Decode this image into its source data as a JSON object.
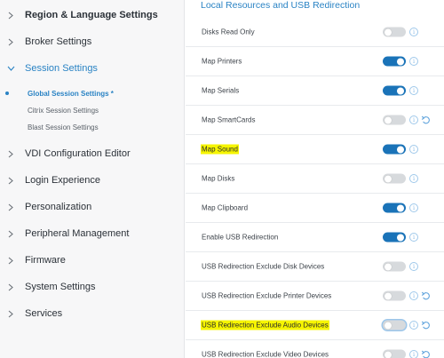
{
  "sidebar": {
    "items": [
      {
        "label": "Region & Language Settings",
        "bold": true,
        "expanded": false
      },
      {
        "label": "Broker Settings",
        "bold": false,
        "expanded": false
      },
      {
        "label": "Session Settings",
        "bold": false,
        "expanded": true,
        "active": true
      },
      {
        "label": "VDI Configuration Editor",
        "bold": false,
        "expanded": false
      },
      {
        "label": "Login Experience",
        "bold": false,
        "expanded": false
      },
      {
        "label": "Personalization",
        "bold": false,
        "expanded": false
      },
      {
        "label": "Peripheral Management",
        "bold": false,
        "expanded": false
      },
      {
        "label": "Firmware",
        "bold": false,
        "expanded": false
      },
      {
        "label": "System Settings",
        "bold": false,
        "expanded": false
      },
      {
        "label": "Services",
        "bold": false,
        "expanded": false
      }
    ],
    "subitems": [
      {
        "label": "Global Session Settings *",
        "active": true
      },
      {
        "label": "Citrix Session Settings",
        "active": false
      },
      {
        "label": "Blast Session Settings",
        "active": false
      }
    ]
  },
  "main": {
    "section_title": "Local Resources and USB Redirection",
    "rows": [
      {
        "label": "Disks Read Only",
        "on": false,
        "highlight": false,
        "reset": false
      },
      {
        "label": "Map Printers",
        "on": true,
        "highlight": false,
        "reset": false
      },
      {
        "label": "Map Serials",
        "on": true,
        "highlight": false,
        "reset": false
      },
      {
        "label": "Map SmartCards",
        "on": false,
        "highlight": false,
        "reset": true
      },
      {
        "label": "Map Sound",
        "on": true,
        "highlight": true,
        "reset": false
      },
      {
        "label": "Map Disks",
        "on": false,
        "highlight": false,
        "reset": false
      },
      {
        "label": "Map Clipboard",
        "on": true,
        "highlight": false,
        "reset": false
      },
      {
        "label": "Enable USB Redirection",
        "on": true,
        "highlight": false,
        "reset": false
      },
      {
        "label": "USB Redirection Exclude Disk Devices",
        "on": false,
        "highlight": false,
        "reset": false
      },
      {
        "label": "USB Redirection Exclude Printer Devices",
        "on": false,
        "highlight": false,
        "reset": true
      },
      {
        "label": "USB Redirection Exclude Audio Devices",
        "on": false,
        "highlight": true,
        "reset": true
      },
      {
        "label": "USB Redirection Exclude Video Devices",
        "on": false,
        "highlight": false,
        "reset": true
      }
    ],
    "info_glyph": "i"
  },
  "colors": {
    "accent": "#2a83c4",
    "toggle_on": "#1a73b8",
    "toggle_off": "#d7dadd",
    "highlight": "#f6f500"
  },
  "icons": {
    "collapsed": "chevron-right-icon",
    "expanded": "chevron-down-icon",
    "info": "info-icon",
    "reset": "undo-icon"
  }
}
